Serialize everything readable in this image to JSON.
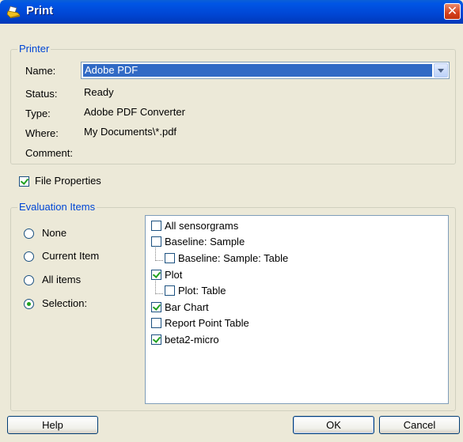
{
  "window": {
    "title": "Print",
    "close_symbol": "✕"
  },
  "printer": {
    "group_label": "Printer",
    "name_label": "Name:",
    "name_value": "Adobe PDF",
    "status_label": "Status:",
    "status_value": "Ready",
    "type_label": "Type:",
    "type_value": "Adobe PDF Converter",
    "where_label": "Where:",
    "where_value": "My Documents\\*.pdf",
    "comment_label": "Comment:"
  },
  "file_properties": {
    "label": "File Properties",
    "checked": true
  },
  "evaluation": {
    "group_label": "Evaluation Items",
    "radios": [
      {
        "label": "None",
        "selected": false
      },
      {
        "label": "Current Item",
        "selected": false
      },
      {
        "label": "All items",
        "selected": false
      },
      {
        "label": "Selection:",
        "selected": true
      }
    ],
    "tree": [
      {
        "label": "All sensorgrams",
        "checked": false,
        "level": 0
      },
      {
        "label": "Baseline: Sample",
        "checked": false,
        "level": 0
      },
      {
        "label": "Baseline: Sample: Table",
        "checked": false,
        "level": 1
      },
      {
        "label": "Plot",
        "checked": true,
        "level": 0
      },
      {
        "label": "Plot: Table",
        "checked": false,
        "level": 1
      },
      {
        "label": "Bar Chart",
        "checked": true,
        "level": 0
      },
      {
        "label": "Report Point Table",
        "checked": false,
        "level": 0
      },
      {
        "label": "beta2-micro",
        "checked": true,
        "level": 0
      }
    ]
  },
  "buttons": {
    "help": "Help",
    "ok": "OK",
    "cancel": "Cancel"
  }
}
